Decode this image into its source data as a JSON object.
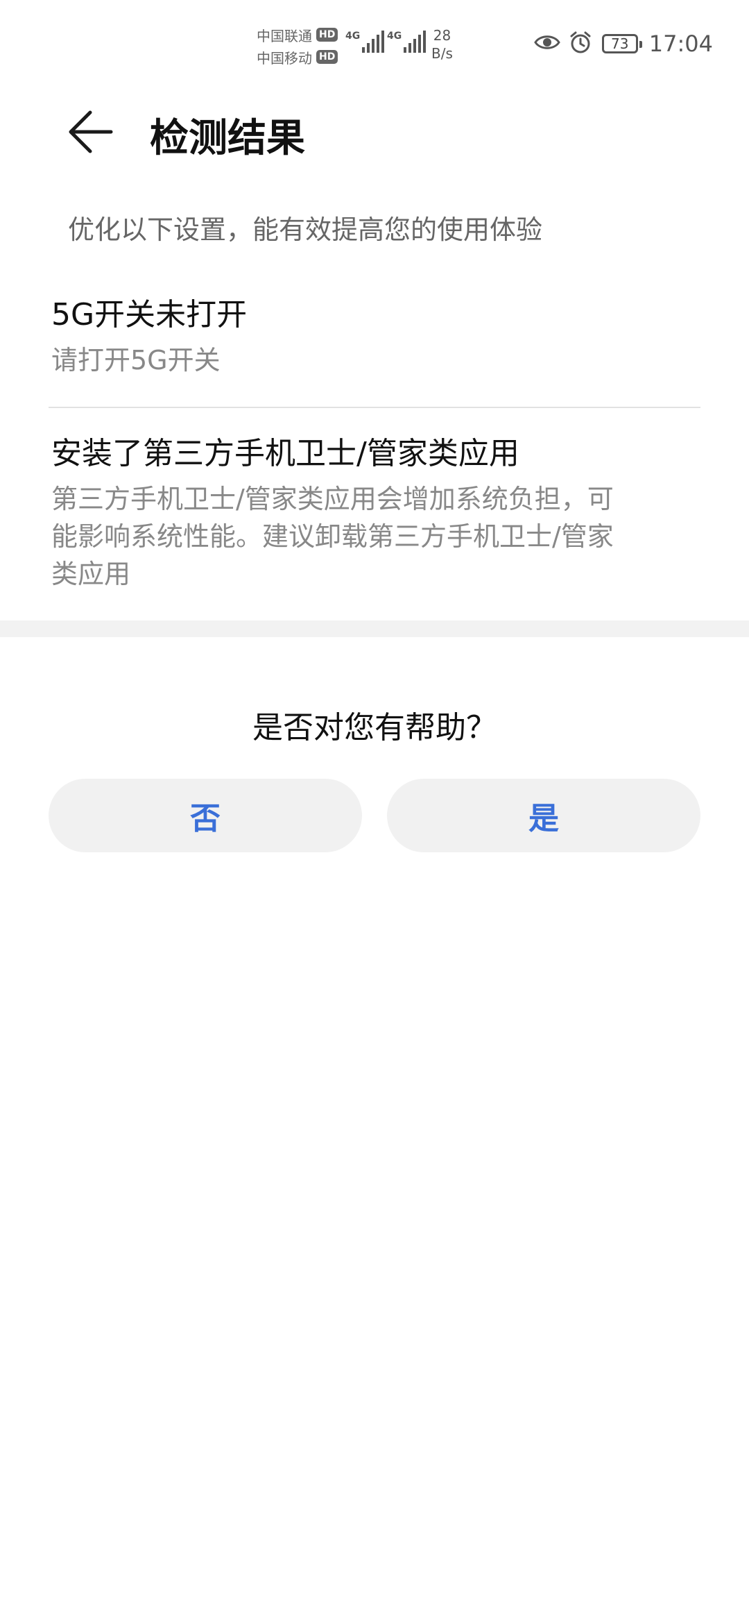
{
  "status_bar": {
    "carrier1": "中国联通",
    "carrier2": "中国移动",
    "hd": "HD",
    "network1": "4G",
    "network2": "4G",
    "speed_value": "28",
    "speed_unit": "B/s",
    "battery": "73",
    "time": "17:04",
    "icons": [
      "eye-comfort-icon",
      "alarm-icon",
      "battery-icon"
    ]
  },
  "header": {
    "title": "检测结果",
    "back_icon": "back-arrow-icon"
  },
  "subtitle": "优化以下设置，能有效提高您的使用体验",
  "items": [
    {
      "title": "5G开关未打开",
      "desc": "请打开5G开关"
    },
    {
      "title": "安装了第三方手机卫士/管家类应用",
      "desc_lines": [
        "第三方手机卫士/管家类应用会增加系统负担，可",
        "能影响系统性能。建议卸载第三方手机卫士/管家",
        "类应用"
      ]
    }
  ],
  "feedback": {
    "question": "是否对您有帮助？",
    "no_label": "否",
    "yes_label": "是",
    "button_text_color": "#3a6fd8"
  }
}
